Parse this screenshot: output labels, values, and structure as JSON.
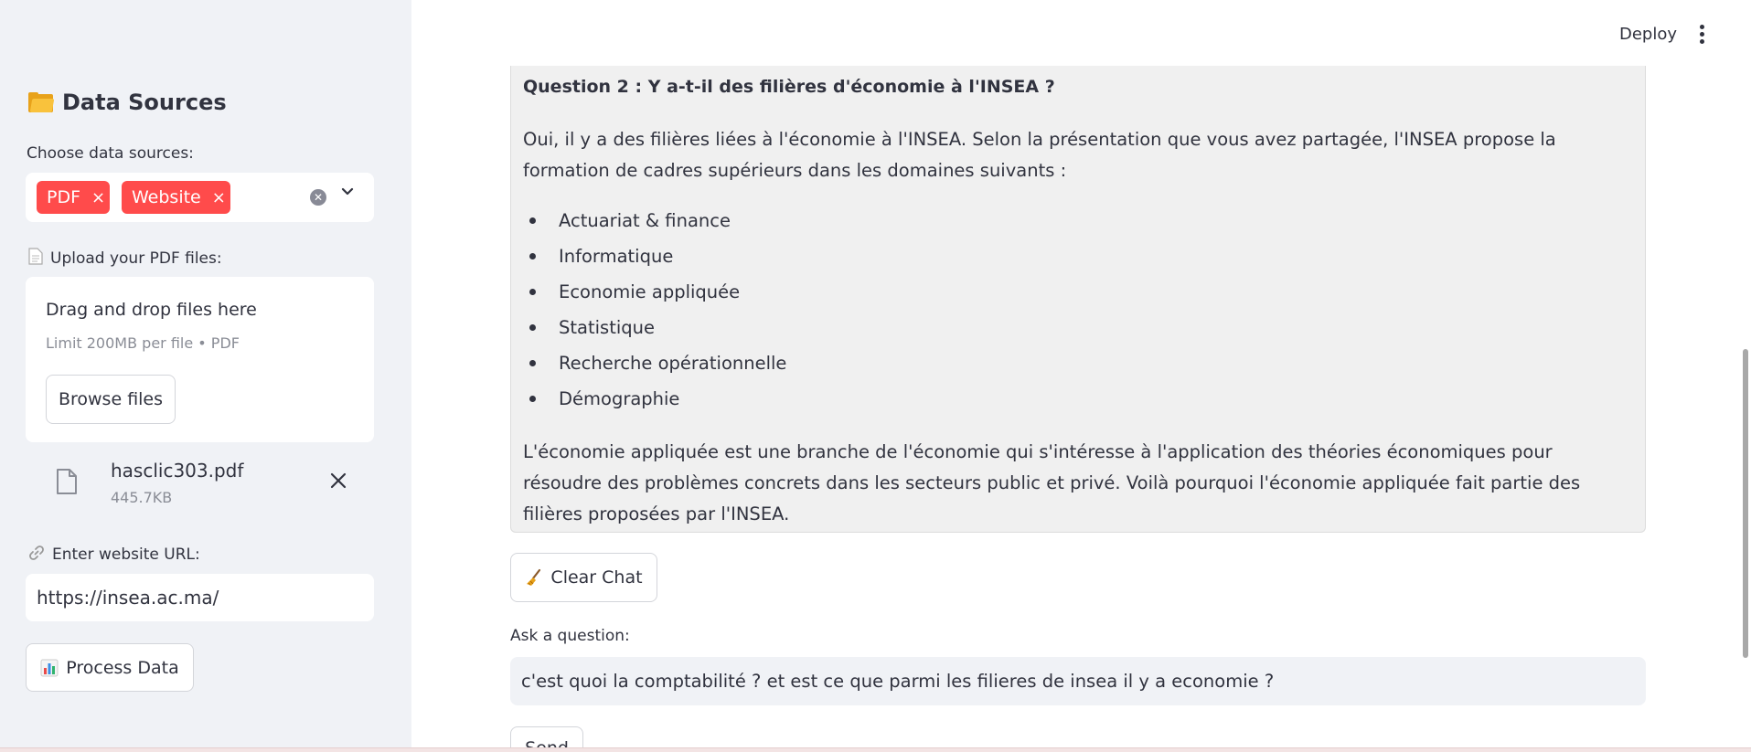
{
  "sidebar": {
    "title": "Data Sources",
    "choose_label": "Choose data sources:",
    "chips": [
      "PDF",
      "Website"
    ],
    "chip_remove": "×",
    "upload_label": "Upload your PDF files:",
    "dropzone_title": "Drag and drop files here",
    "dropzone_limit": "Limit 200MB per file • PDF",
    "browse_label": "Browse files",
    "file": {
      "name": "hasclic303.pdf",
      "size": "445.7KB"
    },
    "url_label": "Enter website URL:",
    "url_value": "https://insea.ac.ma/",
    "process_label": "Process Data"
  },
  "topbar": {
    "deploy": "Deploy"
  },
  "chat": {
    "question": "Question 2 : Y a-t-il des filières d'économie à l'INSEA ?",
    "answer_intro": "Oui, il y a des filières liées à l'économie à l'INSEA. Selon la présentation que vous avez partagée, l'INSEA propose la formation de cadres supérieurs dans les domaines suivants :",
    "items": [
      "Actuariat & finance",
      "Informatique",
      "Economie appliquée",
      "Statistique",
      "Recherche opérationnelle",
      "Démographie"
    ],
    "answer_outro": "L'économie appliquée est une branche de l'économie qui s'intéresse à l'application des théories économiques pour résoudre des problèmes concrets dans les secteurs public et privé. Voilà pourquoi l'économie appliquée fait partie des filières proposées par l'INSEA."
  },
  "actions": {
    "clear_label": "Clear Chat",
    "ask_label": "Ask a question:",
    "ask_value": "c'est quoi la comptabilité ? et est ce que parmi les filieres de insea il y a economie ?",
    "send_label": "Send"
  },
  "colors": {
    "accent": "#ff4b4b",
    "sidebar_bg": "#f0f2f6",
    "chat_bg": "#f0f0f0"
  },
  "icons": {
    "title": "folder-icon",
    "upload": "page-icon",
    "url": "link-icon",
    "file": "file-icon",
    "clear": "broom-icon",
    "process": "bar-chart-icon"
  }
}
